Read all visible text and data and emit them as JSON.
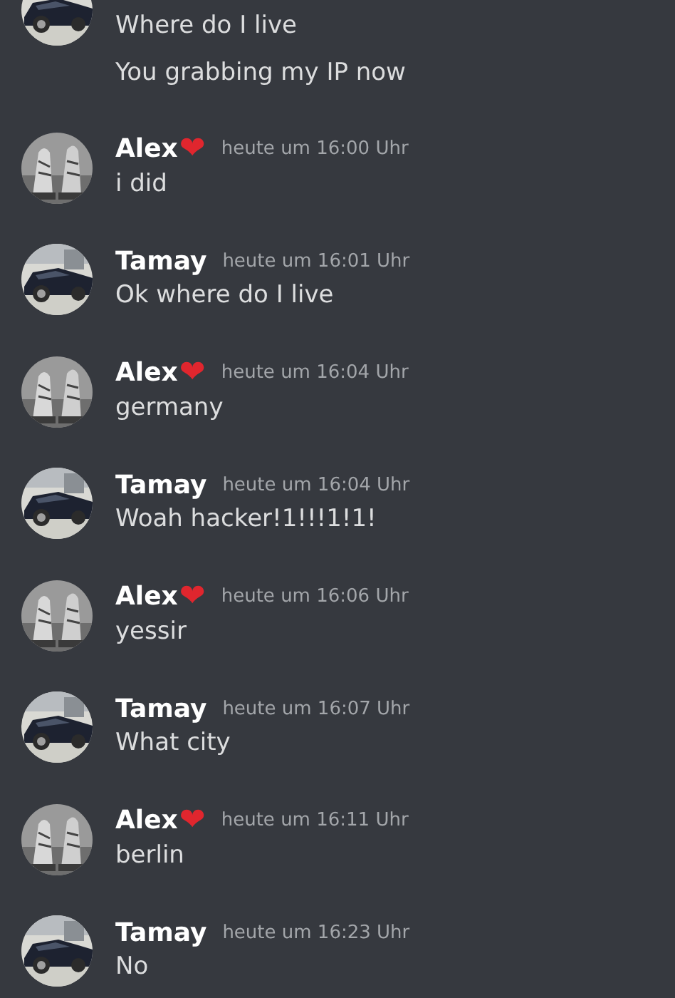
{
  "messages": [
    {
      "avatar": {
        "kind": "picture"
      },
      "lines": [
        "Where do I live",
        "You grabbing my IP now"
      ]
    },
    {
      "author": "Alex",
      "emoji": "❤",
      "avatar": {
        "kind": "picture"
      },
      "time": "heute um 16:00 Uhr",
      "lines": [
        "i did"
      ]
    },
    {
      "author": "Tamay",
      "avatar": {
        "kind": "picture"
      },
      "time": "heute um 16:01 Uhr",
      "lines": [
        "Ok where do I live"
      ]
    },
    {
      "author": "Alex",
      "emoji": "❤",
      "avatar": {
        "kind": "picture"
      },
      "time": "heute um 16:04 Uhr",
      "lines": [
        "germany"
      ]
    },
    {
      "author": "Tamay",
      "avatar": {
        "kind": "picture"
      },
      "time": "heute um 16:04 Uhr",
      "lines": [
        "Woah hacker!1!!!1!1!"
      ]
    },
    {
      "author": "Alex",
      "emoji": "❤",
      "avatar": {
        "kind": "picture"
      },
      "time": "heute um 16:06 Uhr",
      "lines": [
        "yessir"
      ]
    },
    {
      "author": "Tamay",
      "avatar": {
        "kind": "picture"
      },
      "time": "heute um 16:07 Uhr",
      "lines": [
        "What city"
      ]
    },
    {
      "author": "Alex",
      "emoji": "❤",
      "avatar": {
        "kind": "picture"
      },
      "time": "heute um 16:11 Uhr",
      "lines": [
        "berlin"
      ]
    },
    {
      "author": "Tamay",
      "avatar": {
        "kind": "picture"
      },
      "time": "heute um 16:23 Uhr",
      "lines": [
        "No"
      ]
    }
  ]
}
